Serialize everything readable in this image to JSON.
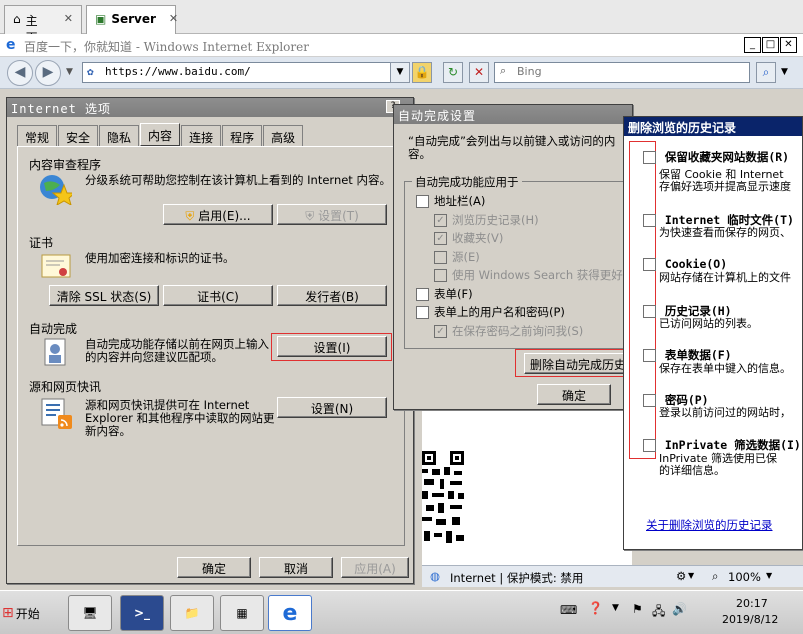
{
  "host_tabs": [
    {
      "label": "主页"
    },
    {
      "label": "Server"
    }
  ],
  "ie": {
    "title": "百度一下，你就知道 - Windows Internet Explorer",
    "address": "https://www.baidu.com/",
    "search_placeholder": "Bing"
  },
  "internet_options": {
    "title": "Internet 选项",
    "tabs": [
      "常规",
      "安全",
      "隐私",
      "内容",
      "连接",
      "程序",
      "高级"
    ],
    "selected_tab": "内容",
    "content_advisor": {
      "heading": "内容审查程序",
      "desc": "分级系统可帮助您控制在该计算机上看到的 Internet 内容。",
      "enable_label": "启用(E)...",
      "settings_label": "设置(T)"
    },
    "certificates": {
      "heading": "证书",
      "desc": "使用加密连接和标识的证书。",
      "clear_ssl_label": "清除 SSL 状态(S)",
      "certs_label": "证书(C)",
      "publishers_label": "发行者(B)"
    },
    "autocomplete": {
      "heading": "自动完成",
      "desc": "自动完成功能存储以前在网页上输入的内容并向您建议匹配项。",
      "settings_label": "设置(I)"
    },
    "feeds": {
      "heading": "源和网页快讯",
      "desc": "源和网页快讯提供可在 Internet Explorer 和其他程序中读取的网站更新内容。",
      "settings_label": "设置(N)"
    },
    "ok_label": "确定",
    "cancel_label": "取消",
    "apply_label": "应用(A)"
  },
  "autocomplete_settings": {
    "title": "自动完成设置",
    "intro": "“自动完成”会列出与以前键入或访问的内容。",
    "group_label": "自动完成功能应用于",
    "items": [
      {
        "label": "地址栏(A)",
        "checked": false,
        "disabled": false,
        "indent": 0
      },
      {
        "label": "浏览历史记录(H)",
        "checked": true,
        "disabled": true,
        "indent": 1
      },
      {
        "label": "收藏夹(V)",
        "checked": true,
        "disabled": true,
        "indent": 1
      },
      {
        "label": "源(E)",
        "checked": false,
        "disabled": true,
        "indent": 1
      },
      {
        "label": "使用 Windows Search 获得更好",
        "checked": false,
        "disabled": true,
        "indent": 1
      },
      {
        "label": "表单(F)",
        "checked": false,
        "disabled": false,
        "indent": 0
      },
      {
        "label": "表单上的用户名和密码(P)",
        "checked": false,
        "disabled": false,
        "indent": 0
      },
      {
        "label": "在保存密码之前询问我(S)",
        "checked": true,
        "disabled": true,
        "indent": 1
      }
    ],
    "delete_history_label": "删除自动完成历史",
    "ok_label": "确定"
  },
  "delete_history": {
    "title": "删除浏览的历史记录",
    "items": [
      {
        "title": "保留收藏夹网站数据(R)",
        "desc": [
          "保留 Cookie 和 Internet",
          "存偏好选项并提高显示速度"
        ]
      },
      {
        "title": "Internet 临时文件(T)",
        "desc": [
          "为快速查看而保存的网页、"
        ]
      },
      {
        "title": "Cookie(O)",
        "desc": [
          "网站存储在计算机上的文件"
        ]
      },
      {
        "title": "历史记录(H)",
        "desc": [
          "已访问网站的列表。"
        ]
      },
      {
        "title": "表单数据(F)",
        "desc": [
          "保存在表单中键入的信息。"
        ]
      },
      {
        "title": "密码(P)",
        "desc": [
          "登录以前访问过的网站时，"
        ]
      },
      {
        "title": "InPrivate 筛选数据(I)",
        "desc": [
          "InPrivate 筛选使用已保",
          "的详细信息。"
        ]
      }
    ],
    "link_label": "关于删除浏览的历史记录"
  },
  "statusbar": {
    "zone": "Internet | 保护模式: 禁用",
    "zoom": "100%"
  },
  "taskbar": {
    "start_label": "开始",
    "time": "20:17",
    "date": "2019/8/12"
  }
}
